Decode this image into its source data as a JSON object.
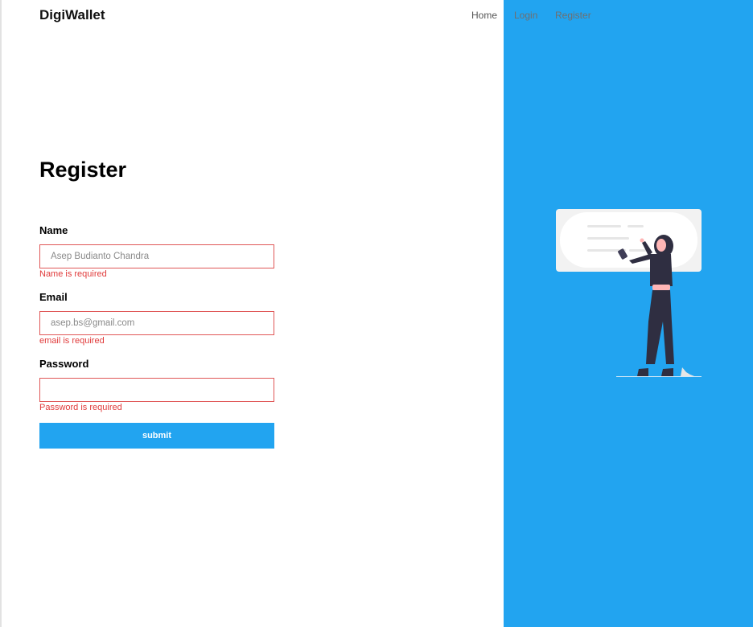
{
  "nav": {
    "brand": "DigiWallet",
    "links": [
      {
        "label": "Home"
      },
      {
        "label": "Login"
      },
      {
        "label": "Register"
      }
    ]
  },
  "form": {
    "title": "Register",
    "fields": [
      {
        "label": "Name",
        "placeholder": "Asep Budianto Chandra",
        "value": "",
        "error": "Name is required"
      },
      {
        "label": "Email",
        "placeholder": "asep.bs@gmail.com",
        "value": "",
        "error": "email is required"
      },
      {
        "label": "Password",
        "placeholder": "",
        "value": "",
        "error": "Password is required"
      }
    ],
    "submit_label": "submit"
  },
  "theme": {
    "accent": "#22a4f0",
    "error": "#e03b3b",
    "figure_jacket": "#2f2e41",
    "figure_belt": "#ffb6b6"
  },
  "illustration": {
    "icon": "woman-with-phone-illustration"
  }
}
